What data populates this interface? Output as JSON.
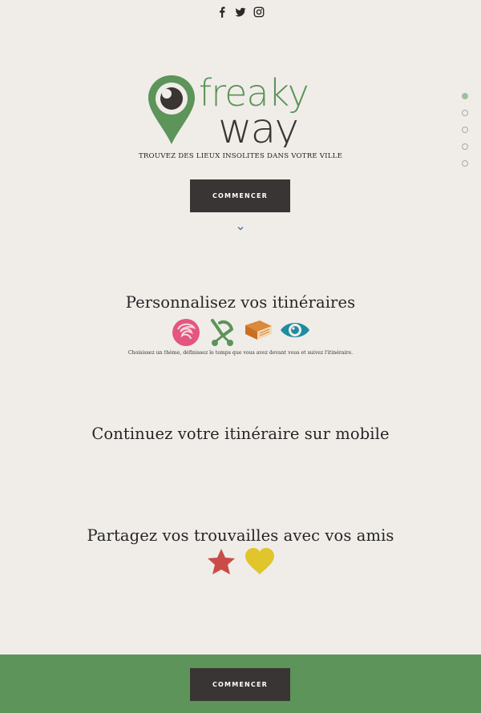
{
  "social": {
    "items": [
      {
        "icon": "facebook-icon"
      },
      {
        "icon": "twitter-icon"
      },
      {
        "icon": "instagram-icon"
      }
    ]
  },
  "brand": {
    "logo_text_top": "freaky",
    "logo_text_bottom": "way",
    "tagline": "TROUVEZ DES LIEUX INSOLITES DANS VOTRE VILLE",
    "colors": {
      "green": "#5c9459",
      "dark": "#383534",
      "background": "#f0ede9"
    }
  },
  "hero": {
    "cta_label": "COMMENCER",
    "scroll_icon": "chevron-down-icon"
  },
  "page_nav": {
    "dot_count": 5,
    "active_index": 0
  },
  "sections": {
    "itineraries": {
      "title": "Personnalisez vos itinéraires",
      "description": "Choisissez un thème, définissez le temps que vous avez devant vous et suivez l'itinéraire.",
      "icons": [
        "rose-icon",
        "stroller-icon",
        "book-icon",
        "eye-icon"
      ]
    },
    "mobile": {
      "title": "Continuez votre itinéraire sur mobile"
    },
    "share": {
      "title": "Partagez vos trouvailles avec vos amis",
      "icons": [
        "star-icon",
        "heart-icon"
      ]
    }
  },
  "footer": {
    "cta_label": "COMMENCER"
  }
}
